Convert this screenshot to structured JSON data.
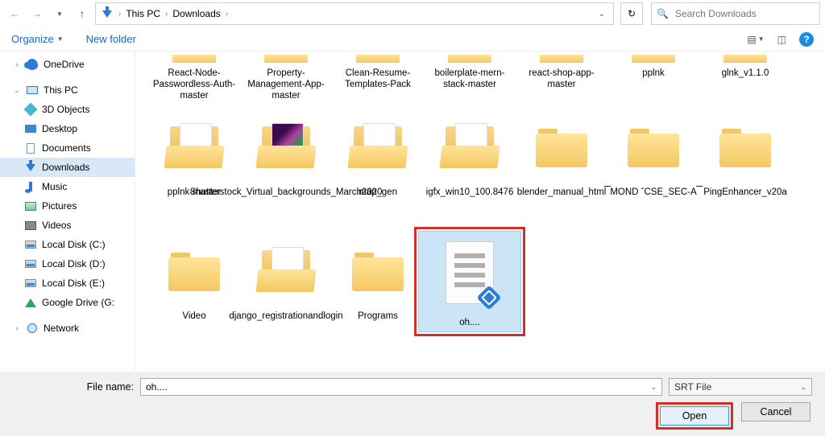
{
  "nav": {
    "breadcrumbs": [
      "This PC",
      "Downloads"
    ]
  },
  "search": {
    "placeholder": "Search Downloads"
  },
  "toolbar": {
    "organize": "Organize",
    "new_folder": "New folder"
  },
  "sidebar": {
    "onedrive": "OneDrive",
    "this_pc": "This PC",
    "objects3d": "3D Objects",
    "desktop": "Desktop",
    "documents": "Documents",
    "downloads": "Downloads",
    "music": "Music",
    "pictures": "Pictures",
    "videos": "Videos",
    "local_c": "Local Disk (C:)",
    "local_d": "Local Disk (D:)",
    "local_e": "Local Disk (E:)",
    "gdrive": "Google Drive (G:",
    "network": "Network"
  },
  "files": {
    "row1": [
      "React-Node-Passwordless-Auth-master",
      "Property-Management-App-master",
      "Clean-Resume-Templates-Pack",
      "boilerplate-mern-stack-master",
      "react-shop-app-master",
      "pplnk",
      "glnk_v1.1.0"
    ],
    "row2": [
      "pplnk-master",
      "Shutterstock_Virtual_backgrounds_March2020",
      "map_gen",
      "igfx_win10_100.8476",
      "blender_manual_html",
      "MOND   ˇCSE_SEC-A",
      "PingEnhancer_v20a"
    ],
    "row3": [
      "Video",
      "django_registrationandlogin",
      "Programs",
      "oh...."
    ],
    "dash_l": "_",
    "dash_r": "_"
  },
  "bottom": {
    "filename_label": "File name:",
    "filename_value": "oh....",
    "filter": "SRT File",
    "open": "Open",
    "cancel": "Cancel"
  }
}
